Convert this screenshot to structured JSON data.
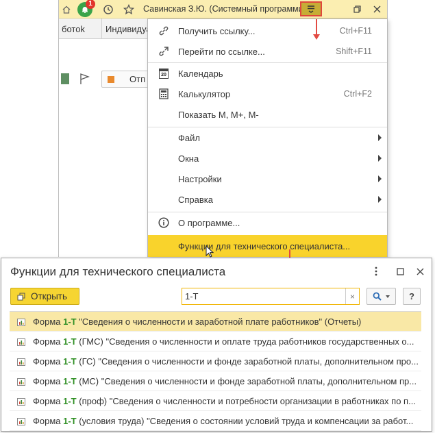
{
  "titlebar": {
    "user": "Савинская З.Ю. (Системный программист)",
    "notification_count": "1",
    "icons": [
      "home-icon",
      "bell-icon",
      "history-icon",
      "star-icon",
      "menu-icon",
      "restore-icon",
      "close-icon"
    ]
  },
  "tabs": [
    {
      "label": "ботоk"
    },
    {
      "label": "Индивидуа"
    }
  ],
  "toolbar": {
    "partial_button": "Отп"
  },
  "menu": {
    "items": [
      {
        "label": "Получить ссылку...",
        "shortcut": "Ctrl+F11",
        "icon": "link-icon"
      },
      {
        "label": "Перейти по ссылке...",
        "shortcut": "Shift+F11",
        "icon": "goto-link-icon"
      },
      {
        "label": "Календарь",
        "shortcut": "",
        "icon": "calendar-icon",
        "icon_text": "20"
      },
      {
        "label": "Калькулятор",
        "shortcut": "Ctrl+F2",
        "icon": "calculator-icon"
      },
      {
        "label": "Показать М, М+, М-",
        "shortcut": ""
      },
      {
        "label": "Файл",
        "submenu": true
      },
      {
        "label": "Окна",
        "submenu": true
      },
      {
        "label": "Настройки",
        "submenu": true
      },
      {
        "label": "Справка",
        "submenu": true
      },
      {
        "label": "О программе...",
        "icon": "info-icon"
      },
      {
        "label": "Функции для технического специалиста...",
        "highlighted": true
      }
    ]
  },
  "dialog": {
    "title": "Функции для технического специалиста",
    "open_button": "Открыть",
    "search_value": "1-Т",
    "help_label": "?",
    "results": [
      {
        "pre": "Форма ",
        "match": "1-Т",
        "post": " \"Сведения о численности и заработной плате работников\" (Отчеты)"
      },
      {
        "pre": "Форма ",
        "match": "1-Т",
        "post": " (ГМС) \"Сведения о численности и оплате труда работников государственных о..."
      },
      {
        "pre": "Форма ",
        "match": "1-Т",
        "post": " (ГС) \"Сведения о численности и фонде заработной платы, дополнительном про..."
      },
      {
        "pre": "Форма ",
        "match": "1-Т",
        "post": " (МС) \"Сведения о численности и фонде заработной платы, дополнительном пр..."
      },
      {
        "pre": "Форма ",
        "match": "1-Т",
        "post": " (проф) \"Сведения о численности и потребности организации в работниках по п..."
      },
      {
        "pre": "Форма ",
        "match": "1-Т",
        "post": " (условия труда) \"Сведения о состоянии условий труда и компенсации за работ..."
      }
    ]
  },
  "colors": {
    "titlebar_bg": "#fbeeb1",
    "accent_yellow": "#f9d32c",
    "selected_row": "#f9e8a6",
    "match_green": "#2f8f24",
    "annotation_red": "#e24a43"
  }
}
